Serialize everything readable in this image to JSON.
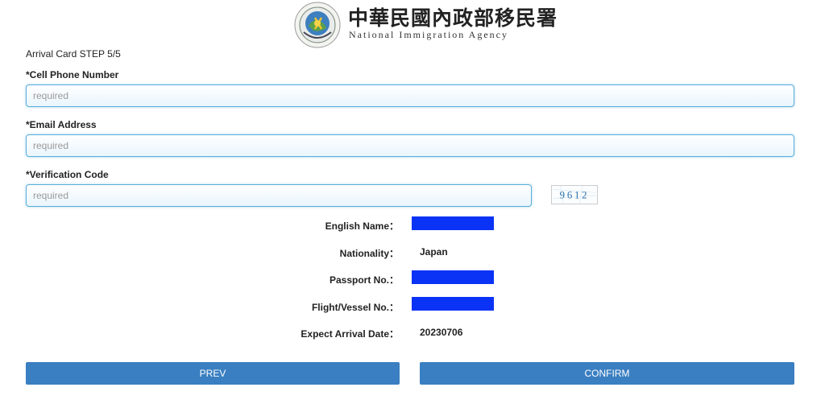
{
  "header": {
    "agency_cn": "中華民國內政部移民署",
    "agency_en": "National Immigration Agency",
    "logo_icon": "nia-emblem-icon"
  },
  "form": {
    "step": "Arrival Card STEP 5/5",
    "phone": {
      "label": "*Cell Phone Number",
      "placeholder": "required",
      "value": ""
    },
    "email": {
      "label": "*Email Address",
      "placeholder": "required",
      "value": ""
    },
    "verification": {
      "label": "*Verification Code",
      "placeholder": "required",
      "value": "",
      "captcha": "9612"
    }
  },
  "info": {
    "english_name": {
      "label": "English Name：",
      "value": ""
    },
    "nationality": {
      "label": "Nationality：",
      "value": "Japan"
    },
    "passport": {
      "label": "Passport No.：",
      "value": ""
    },
    "flight": {
      "label": "Flight/Vessel No.：",
      "value": ""
    },
    "arrival_date": {
      "label": "Expect Arrival Date：",
      "value": "20230706"
    }
  },
  "buttons": {
    "prev": "PREV",
    "confirm": "CONFIRM"
  },
  "colors": {
    "accent": "#3a7fc1",
    "input_border": "#5aaedb",
    "redaction": "#0a33f5"
  }
}
